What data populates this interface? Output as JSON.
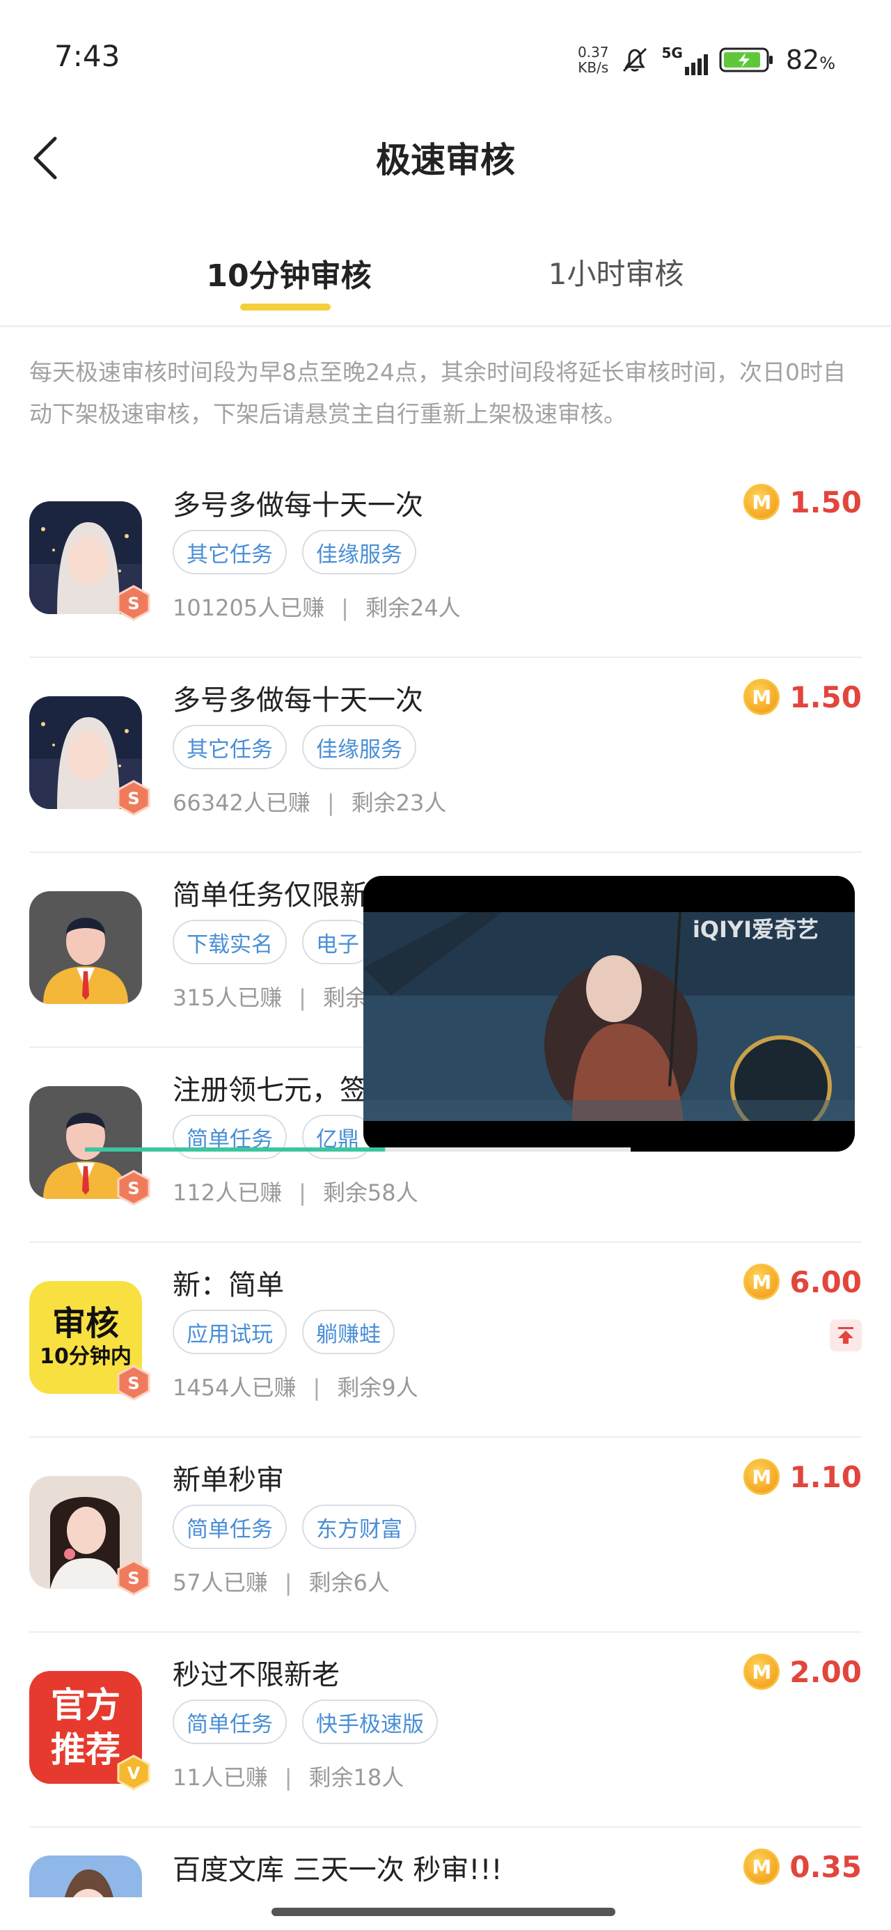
{
  "status_bar": {
    "time": "7:43",
    "net_speed_value": "0.37",
    "net_speed_unit": "KB/s",
    "network": "5G",
    "battery": "82",
    "battery_unit": "%"
  },
  "header": {
    "title": "极速审核"
  },
  "tabs": [
    {
      "label": "10分钟审核",
      "active": true
    },
    {
      "label": "1小时审核",
      "active": false
    }
  ],
  "notice": "每天极速审核时间段为早8点至晚24点，其余时间段将延长审核时间，次日0时自动下架极速审核，下架后请悬赏主自行重新上架极速审核。",
  "tasks": [
    {
      "title": "多号多做每十天一次",
      "tags": [
        "其它任务",
        "佳缘服务"
      ],
      "earned": "101205人已赚",
      "remaining": "剩余24人",
      "price": "1.50",
      "badge": "S",
      "avatar": "avatar-girl-city"
    },
    {
      "title": "多号多做每十天一次",
      "tags": [
        "其它任务",
        "佳缘服务"
      ],
      "earned": "66342人已赚",
      "remaining": "剩余23人",
      "price": "1.50",
      "badge": "S",
      "avatar": "avatar-girl-city"
    },
    {
      "title": "简单任务仅限新",
      "tags": [
        "下载实名",
        "电子"
      ],
      "earned": "315人已赚",
      "remaining": "剩余",
      "price": "",
      "badge": "",
      "avatar": "avatar-default-man"
    },
    {
      "title": "注册领七元，签",
      "tags": [
        "简单任务",
        "亿鼎"
      ],
      "earned": "112人已赚",
      "remaining": "剩余58人",
      "price": "",
      "badge": "S",
      "avatar": "avatar-default-man"
    },
    {
      "title": "新：简单",
      "tags": [
        "应用试玩",
        "躺赚蛙"
      ],
      "earned": "1454人已赚",
      "remaining": "剩余9人",
      "price": "6.00",
      "badge": "S",
      "avatar": "avatar-review-10min",
      "avatar_text_top": "审核",
      "avatar_text_bottom": "10分钟内",
      "pinned": true
    },
    {
      "title": "新单秒审",
      "tags": [
        "简单任务",
        "东方财富"
      ],
      "earned": "57人已赚",
      "remaining": "剩余6人",
      "price": "1.10",
      "badge": "S",
      "avatar": "avatar-girl-portrait"
    },
    {
      "title": "秒过不限新老",
      "tags": [
        "简单任务",
        "快手极速版"
      ],
      "earned": "11人已赚",
      "remaining": "剩余18人",
      "price": "2.00",
      "badge": "V",
      "avatar": "avatar-official",
      "avatar_text_top": "官方",
      "avatar_text_bottom": "推荐"
    },
    {
      "title": "百度文库  三天一次  秒审!!!",
      "tags": [],
      "earned": "",
      "remaining": "",
      "price": "0.35",
      "badge": "",
      "avatar": "avatar-girl-sky"
    }
  ],
  "coin_symbol": "M",
  "separator": "|",
  "video": {
    "brand": "iQIYI爱奇艺",
    "progress": 0.55
  },
  "colors": {
    "accent": "#f4cf3b",
    "price": "#e2453c",
    "tag_text": "#4a8fd6"
  }
}
